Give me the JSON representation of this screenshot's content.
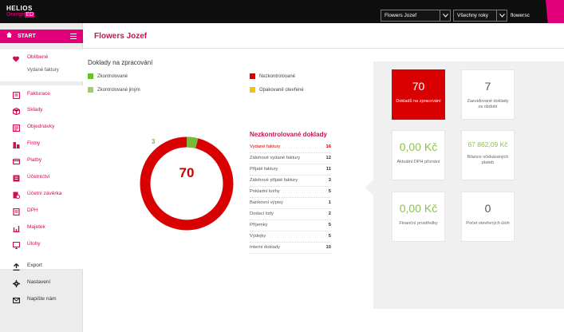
{
  "header": {
    "logo_top": "HELIOS",
    "logo_bottom_text": "Orange",
    "logo_bottom_badge": "ED",
    "company_select": "Flowers Jozef",
    "year_select": "Všechny roky",
    "user": "flowersc"
  },
  "sidebar": {
    "start_label": "START",
    "favorites_label": "Oblíbené",
    "favorites_sub": "Vydané faktury",
    "items": [
      {
        "label": "Fakturace",
        "icon": "invoice-icon"
      },
      {
        "label": "Sklady",
        "icon": "warehouse-icon"
      },
      {
        "label": "Objednávky",
        "icon": "orders-icon"
      },
      {
        "label": "Firmy",
        "icon": "companies-icon"
      },
      {
        "label": "Platby",
        "icon": "payments-icon"
      },
      {
        "label": "Účetnictví",
        "icon": "accounting-icon"
      },
      {
        "label": "Účetní závěrka",
        "icon": "closing-icon"
      },
      {
        "label": "DPH",
        "icon": "vat-icon"
      },
      {
        "label": "Majetek",
        "icon": "assets-icon"
      },
      {
        "label": "Úlohy",
        "icon": "tasks-icon"
      }
    ],
    "bottom": [
      {
        "label": "Export",
        "icon": "export-icon"
      },
      {
        "label": "Nastavení",
        "icon": "settings-icon"
      },
      {
        "label": "Napište nám",
        "icon": "mail-icon"
      }
    ]
  },
  "main": {
    "title": "Flowers Jozef",
    "section_title": "Doklady na zpracování",
    "legend": [
      {
        "label": "Zkontrolované",
        "color": "#6bbf2a"
      },
      {
        "label": "Zkontrolované jiným",
        "color": "#a6c878"
      },
      {
        "label": "Nezkontrolované",
        "color": "#d80000"
      },
      {
        "label": "Opakovaně otevřené",
        "color": "#f5c200"
      }
    ],
    "donut": {
      "green_count": "3",
      "center_value": "70",
      "green_fraction": 0.04
    },
    "table_title": "Nezkontrolované doklady",
    "rows": [
      {
        "label": "Vydané faktury",
        "value": "16"
      },
      {
        "label": "Zálohové vydané faktury",
        "value": "12"
      },
      {
        "label": "Přijaté faktury",
        "value": "11"
      },
      {
        "label": "Zálohové přijaté faktury",
        "value": "3"
      },
      {
        "label": "Pokladní knihy",
        "value": "5"
      },
      {
        "label": "Bankovní výpisy",
        "value": "1"
      },
      {
        "label": "Dodací listy",
        "value": "2"
      },
      {
        "label": "Příjemky",
        "value": "5"
      },
      {
        "label": "Výdejky",
        "value": "5"
      },
      {
        "label": "Interní doklady",
        "value": "10"
      }
    ]
  },
  "tiles": [
    {
      "value": "70",
      "label": "Dokladů na zpracování"
    },
    {
      "value": "7",
      "label": "Zaevidované doklady za období"
    },
    {
      "value": "0,00 Kč",
      "label": "Aktuální DPH přiznání"
    },
    {
      "value": "67 862,09 Kč",
      "label": "Bilance očekávaných plateb"
    },
    {
      "value": "0,00 Kč",
      "label": "Finanční prostředky"
    },
    {
      "value": "0",
      "label": "Počet otevřených úloh"
    }
  ]
}
